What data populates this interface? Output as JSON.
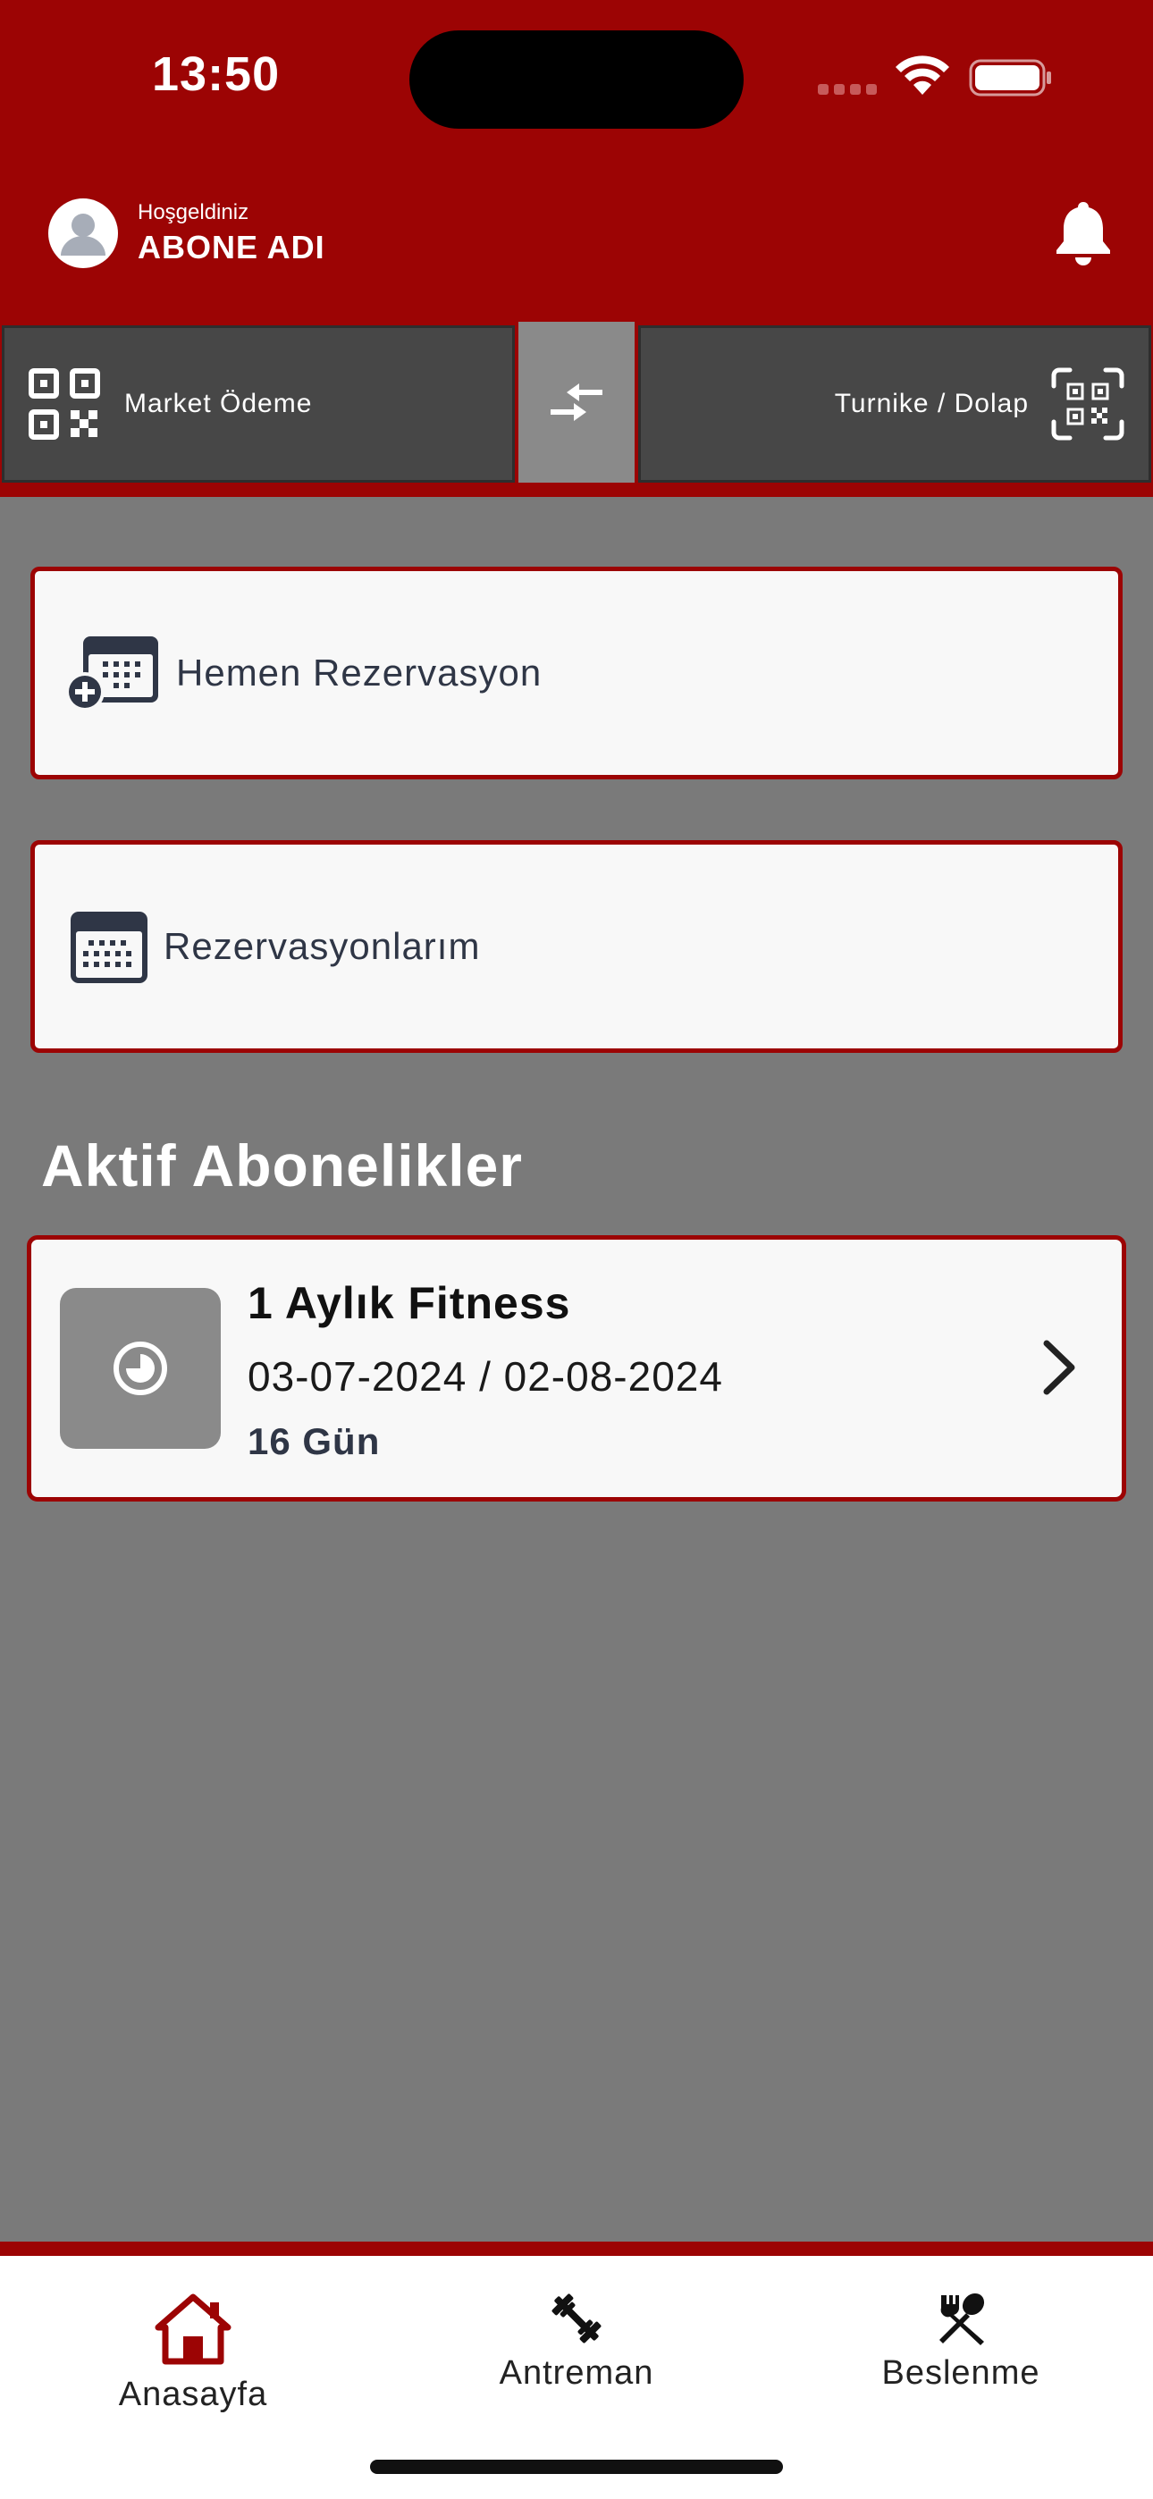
{
  "status_bar": {
    "time": "13:50"
  },
  "header": {
    "welcome": "Hoşgeldiniz",
    "username": "ABONE ADI"
  },
  "qr_bar": {
    "left_label": "Market Ödeme",
    "right_label": "Turnike / Dolap"
  },
  "actions": [
    {
      "label": "Hemen Rezervasyon",
      "icon": "calendar-add-icon"
    },
    {
      "label": "Rezervasyonlarım",
      "icon": "calendar-icon"
    }
  ],
  "subscriptions": {
    "title": "Aktif Abonelikler",
    "items": [
      {
        "name": "1 Aylık Fitness",
        "dates": "03-07-2024 / 02-08-2024",
        "days_left": "16 Gün"
      }
    ]
  },
  "bottom_nav": [
    {
      "label": "Anasayfa",
      "icon": "home-icon",
      "active": true
    },
    {
      "label": "Antreman",
      "icon": "dumbbell-icon",
      "active": false
    },
    {
      "label": "Beslenme",
      "icon": "utensils-icon",
      "active": false
    }
  ],
  "colors": {
    "brand": "#9c0404",
    "background": "#7a7a7a",
    "card": "#f8f8f8",
    "dark_button": "#474747"
  }
}
